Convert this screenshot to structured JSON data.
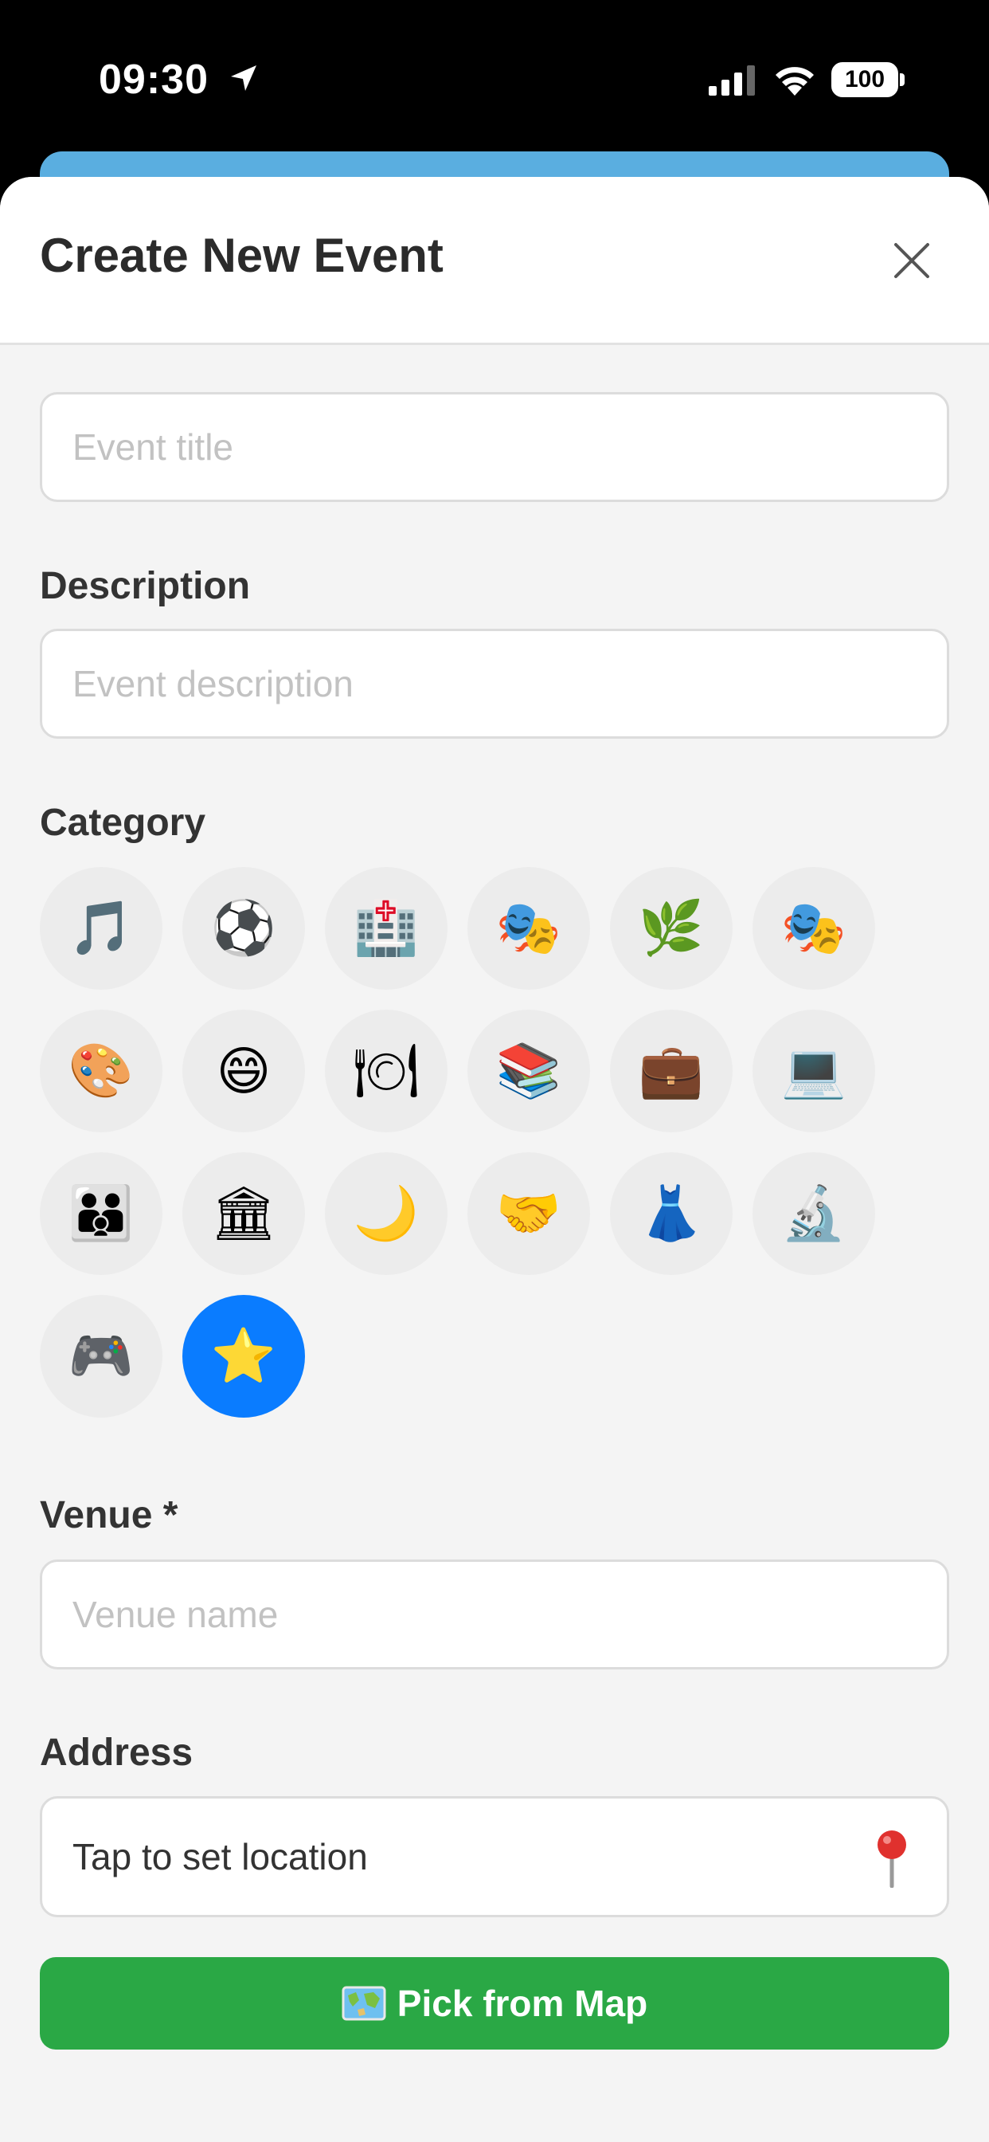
{
  "status_bar": {
    "time": "09:30",
    "battery": "100"
  },
  "sheet": {
    "title": "Create New Event",
    "fields": {
      "title_placeholder": "Event title",
      "description_label": "Description",
      "description_placeholder": "Event description",
      "category_label": "Category",
      "venue_label": "Venue *",
      "venue_placeholder": "Venue name",
      "address_label": "Address",
      "address_value": "Tap to set location"
    },
    "categories": [
      {
        "icon": "music-note-icon",
        "glyph": "🎵"
      },
      {
        "icon": "soccer-ball-icon",
        "glyph": "⚽"
      },
      {
        "icon": "hospital-icon",
        "glyph": "🏥"
      },
      {
        "icon": "theater-masks-icon",
        "glyph": "🎭"
      },
      {
        "icon": "herb-icon",
        "glyph": "🌿"
      },
      {
        "icon": "theater-masks-icon",
        "glyph": "🎭"
      },
      {
        "icon": "artist-palette-icon",
        "glyph": "🎨"
      },
      {
        "icon": "grinning-face-icon",
        "glyph": "😄"
      },
      {
        "icon": "plate-cutlery-icon",
        "glyph": "🍽"
      },
      {
        "icon": "books-icon",
        "glyph": "📚"
      },
      {
        "icon": "briefcase-icon",
        "glyph": "💼"
      },
      {
        "icon": "laptop-icon",
        "glyph": "💻"
      },
      {
        "icon": "family-icon",
        "glyph": "👪"
      },
      {
        "icon": "classical-building-icon",
        "glyph": "🏛"
      },
      {
        "icon": "crescent-moon-icon",
        "glyph": "🌙"
      },
      {
        "icon": "handshake-icon",
        "glyph": "🤝"
      },
      {
        "icon": "dress-icon",
        "glyph": "👗"
      },
      {
        "icon": "microscope-icon",
        "glyph": "🔬"
      },
      {
        "icon": "game-controller-icon",
        "glyph": "🎮"
      },
      {
        "icon": "star-icon",
        "glyph": "⭐",
        "selected": true
      }
    ],
    "map_button_label": "Pick from Map"
  },
  "colors": {
    "accent_blue": "#0a7cff",
    "map_button_green": "#2aa845"
  }
}
